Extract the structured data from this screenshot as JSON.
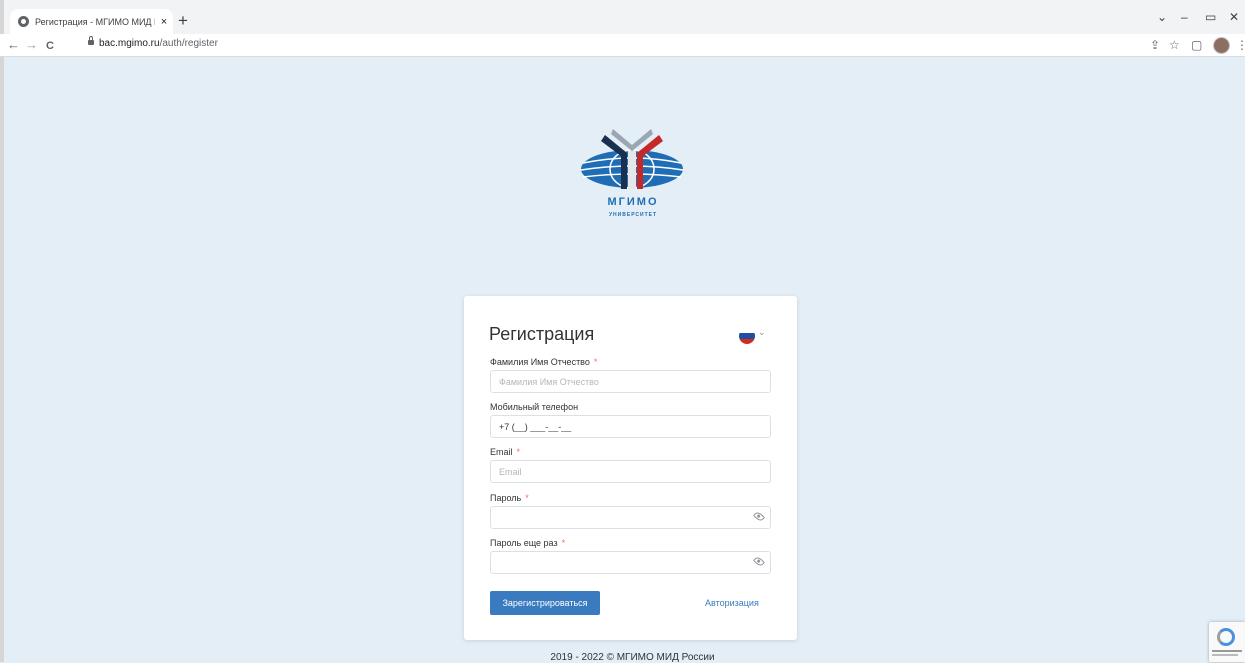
{
  "browser": {
    "tab_title": "Регистрация - МГИМО МИД Ро",
    "tab_close": "×",
    "new_tab": "+",
    "url_host": "bac.mgimo.ru",
    "url_path": "/auth/register",
    "controls": {
      "dropdown": "⌄",
      "minimize": "–",
      "restore": "▭",
      "close": "✕"
    },
    "nav": {
      "back": "←",
      "forward": "→",
      "reload": "C"
    },
    "toolbar": {
      "share": "⇪",
      "star": "☆",
      "sidepanel": "▢",
      "menu": "⋮"
    }
  },
  "logo": {
    "name_line1": "МГИМО",
    "name_line2": "УНИВЕРСИТЕТ"
  },
  "form": {
    "title": "Регистрация",
    "language_chevron": "⌄",
    "fields": {
      "fullname": {
        "label": "Фамилия Имя Отчество",
        "required_mark": "*",
        "placeholder": "Фамилия Имя Отчество",
        "value": ""
      },
      "phone": {
        "label": "Мобильный телефон",
        "value": "+7 (__) ___-__-__"
      },
      "email": {
        "label": "Email",
        "required_mark": "*",
        "placeholder": "Email",
        "value": ""
      },
      "password": {
        "label": "Пароль",
        "required_mark": "*",
        "value": ""
      },
      "password_repeat": {
        "label": "Пароль еще раз",
        "required_mark": "*",
        "value": ""
      }
    },
    "submit_label": "Зарегистрироваться",
    "login_link": "Авторизация"
  },
  "footer": {
    "text": "2019 - 2022 © МГИМО МИД России"
  },
  "colors": {
    "page_bg": "#e3eef6",
    "button": "#3a7bbf",
    "required": "#f56c6c",
    "logo_blue": "#1f6db5",
    "logo_red": "#c62828"
  }
}
